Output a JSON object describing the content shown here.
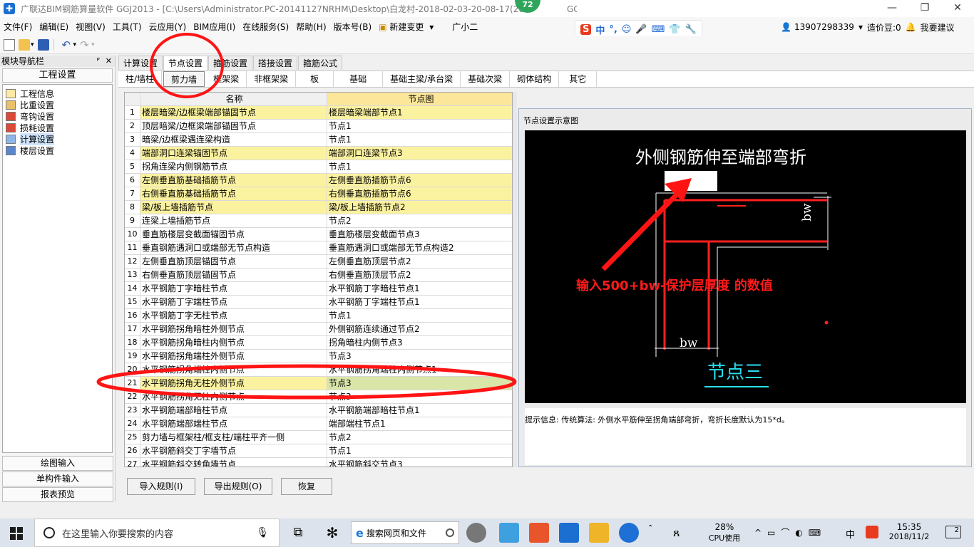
{
  "window": {
    "title": "广联达BIM钢筋算量软件 GGJ2013 - [C:\\Users\\Administrator.PC-20141127NRHM\\Desktop\\白龙村-2018-02-03-20-08-17(26",
    "title_tail": "GGJ12]",
    "badge": "72",
    "buttons": [
      "—",
      "❐",
      "✕"
    ]
  },
  "menubar": {
    "items": [
      "文件(F)",
      "编辑(E)",
      "视图(V)",
      "工具(T)",
      "云应用(Y)",
      "BIM应用(I)",
      "在线服务(S)",
      "帮助(H)",
      "版本号(B)",
      "新建变更",
      "广小二"
    ],
    "new_change_arrow": "▾"
  },
  "ime": {
    "logo": "S",
    "items": [
      "中",
      "°,",
      "☺",
      "🎤",
      "⌨",
      "👕",
      "🔧"
    ]
  },
  "account": {
    "phone": "13907298339",
    "points": "造价豆:0",
    "suggest": "我要建议"
  },
  "nav": {
    "title": "模块导航栏",
    "pin": "ᴾ",
    "close": "✕",
    "group": "工程设置",
    "items": [
      "工程信息",
      "比重设置",
      "弯钩设置",
      "损耗设置",
      "计算设置",
      "楼层设置"
    ],
    "bottom": [
      "绘图输入",
      "单构件输入",
      "报表预览"
    ]
  },
  "tabs_top": [
    "计算设置",
    "节点设置",
    "箍筋设置",
    "搭接设置",
    "箍筋公式"
  ],
  "tabs_sub": [
    "柱/墙柱",
    "剪力墙",
    "框架梁",
    "非框架梁",
    "板",
    "基础",
    "基础主梁/承台梁",
    "基础次梁",
    "砌体结构",
    "其它"
  ],
  "grid": {
    "headers": [
      "名称",
      "节点图"
    ],
    "rows": [
      {
        "n": "1",
        "name": "楼层暗梁/边框梁端部锚固节点",
        "node": "楼层暗梁端部节点1",
        "hl": true
      },
      {
        "n": "2",
        "name": "顶层暗梁/边框梁端部锚固节点",
        "node": "节点1",
        "hl": false
      },
      {
        "n": "3",
        "name": "暗梁/边框梁遇连梁构造",
        "node": "节点1",
        "hl": false
      },
      {
        "n": "4",
        "name": "端部洞口连梁锚固节点",
        "node": "端部洞口连梁节点3",
        "hl": true
      },
      {
        "n": "5",
        "name": "拐角连梁内侧钢筋节点",
        "node": "节点1",
        "hl": false
      },
      {
        "n": "6",
        "name": "左侧垂直筋基础插筋节点",
        "node": "左侧垂直筋插筋节点6",
        "hl": true
      },
      {
        "n": "7",
        "name": "右侧垂直筋基础插筋节点",
        "node": "右侧垂直筋插筋节点6",
        "hl": true
      },
      {
        "n": "8",
        "name": "梁/板上墙插筋节点",
        "node": "梁/板上墙插筋节点2",
        "hl": true
      },
      {
        "n": "9",
        "name": "连梁上墙插筋节点",
        "node": "节点2",
        "hl": false
      },
      {
        "n": "10",
        "name": "垂直筋楼层变截面锚固节点",
        "node": "垂直筋楼层变截面节点3",
        "hl": false
      },
      {
        "n": "11",
        "name": "垂直钢筋遇洞口或端部无节点构造",
        "node": "垂直筋遇洞口或端部无节点构造2",
        "hl": false
      },
      {
        "n": "12",
        "name": "左侧垂直筋顶层锚固节点",
        "node": "左侧垂直筋顶层节点2",
        "hl": false
      },
      {
        "n": "13",
        "name": "右侧垂直筋顶层锚固节点",
        "node": "右侧垂直筋顶层节点2",
        "hl": false
      },
      {
        "n": "14",
        "name": "水平钢筋丁字暗柱节点",
        "node": "水平钢筋丁字暗柱节点1",
        "hl": false
      },
      {
        "n": "15",
        "name": "水平钢筋丁字端柱节点",
        "node": "水平钢筋丁字端柱节点1",
        "hl": false
      },
      {
        "n": "16",
        "name": "水平钢筋丁字无柱节点",
        "node": "节点1",
        "hl": false
      },
      {
        "n": "17",
        "name": "水平钢筋拐角暗柱外侧节点",
        "node": "外侧钢筋连续通过节点2",
        "hl": false
      },
      {
        "n": "18",
        "name": "水平钢筋拐角暗柱内侧节点",
        "node": "拐角暗柱内侧节点3",
        "hl": false
      },
      {
        "n": "19",
        "name": "水平钢筋拐角端柱外侧节点",
        "node": "节点3",
        "hl": false
      },
      {
        "n": "20",
        "name": "水平钢筋拐角端柱内侧节点",
        "node": "水平钢筋拐角端柱内侧节点1",
        "hl": false
      },
      {
        "n": "21",
        "name": "水平钢筋拐角无柱外侧节点",
        "node": "节点3",
        "hl": false,
        "sel": true
      },
      {
        "n": "22",
        "name": "水平钢筋拐角无柱内侧节点",
        "node": "节点3",
        "hl": false
      },
      {
        "n": "23",
        "name": "水平钢筋端部暗柱节点",
        "node": "水平钢筋端部暗柱节点1",
        "hl": false
      },
      {
        "n": "24",
        "name": "水平钢筋端部端柱节点",
        "node": "端部端柱节点1",
        "hl": false
      },
      {
        "n": "25",
        "name": "剪力墙与框架柱/框支柱/端柱平齐一侧",
        "node": "节点2",
        "hl": false
      },
      {
        "n": "26",
        "name": "水平钢筋斜交丁字墙节点",
        "node": "节点1",
        "hl": false
      },
      {
        "n": "27",
        "name": "水平钢筋斜交转角墙节点",
        "node": "水平钢筋斜交节点3",
        "hl": false
      }
    ]
  },
  "diagram": {
    "caption": "节点设置示意图",
    "title": "外侧钢筋伸至端部弯折",
    "label_bw_right": "bw",
    "label_bw_bottom": "bw",
    "node_name": "节点三",
    "annotation": "输入500+bw-保护层厚度 的数值",
    "hint": "提示信息: 传统算法: 外侧水平筋伸至拐角端部弯折，弯折长度默认为15*d。"
  },
  "buttons": [
    "导入规则(I)",
    "导出规则(O)",
    "恢复"
  ],
  "taskbar": {
    "search_placeholder": "在这里输入你要搜索的内容",
    "browser_search": "搜索网页和文件",
    "cpu": "28%",
    "cpu_label": "CPU使用",
    "ime": "中",
    "time": "15:35",
    "date": "2018/11/2",
    "notif": "2"
  },
  "colors": {
    "accent": "#1a6fd1",
    "highlight": "#fbf2a0",
    "selected_cell": "#d9e6a8",
    "annotation": "#ff1a1a",
    "diagram_bg": "#000000"
  }
}
